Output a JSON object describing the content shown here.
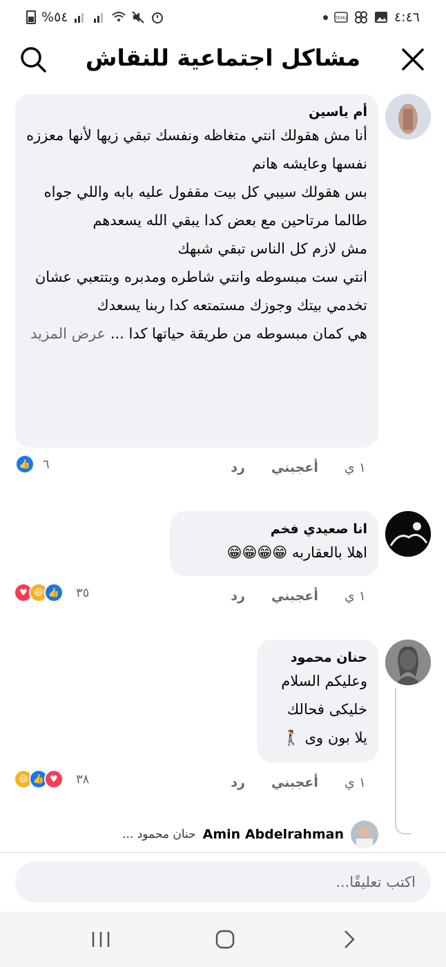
{
  "status_bar": {
    "time": "٤:٤٦",
    "battery": "%٥٤"
  },
  "header": {
    "title": "مشاكل اجتماعية للنقاش",
    "search_icon": "search-icon",
    "close_icon": "close-icon"
  },
  "comments": [
    {
      "author": "أم ياسين",
      "text": "أنا مش هقولك انتي متغاظه ونفسك تبقي زيها لأنها معززه نفسها وعايشه هانم\nبس هقولك سيبي كل بيت مقفول عليه بابه واللي جواه طالما مرتاحين مع بعض كدا يبقي الله يسعدهم\nمش لازم كل الناس تبقي شبهك\nانتي ست مبسوطه وانتي شاطره ومدبره وبتتعبي عشان تخدمي بيتك وجوزك مستمتعه كدا  ربنا يسعدك\nهي كمان مبسوطه من طريقة حياتها كدا ...",
      "see_more": "عرض المزيد",
      "age": "١ ي",
      "like": "أعجبني",
      "reply": "رد",
      "reaction_count": "٦"
    },
    {
      "author": "انا صعيدي فخم",
      "text": "اهلا بالعقاربه 😁😁😁😁",
      "age": "١ ي",
      "like": "أعجبني",
      "reply": "رد",
      "reaction_count": "٣٥"
    },
    {
      "author": "حنان محمود",
      "text": "وعليكم السلام\nخليكى فحالك\nيلا بون وى 🚶‍♀️",
      "age": "١ ي",
      "like": "أعجبني",
      "reply": "رد",
      "reaction_count": "٣٨"
    }
  ],
  "reply_preview": {
    "author": "Amin Abdelrahman",
    "snippet": "حنان محمود ..."
  },
  "composer": {
    "placeholder": "اكتب تعليقًا..."
  },
  "colors": {
    "bubble": "#f0f2f5",
    "like_blue": "#1877f2",
    "haha_yellow": "#f7b125",
    "love_red": "#f33e58",
    "muted": "#65676b"
  }
}
